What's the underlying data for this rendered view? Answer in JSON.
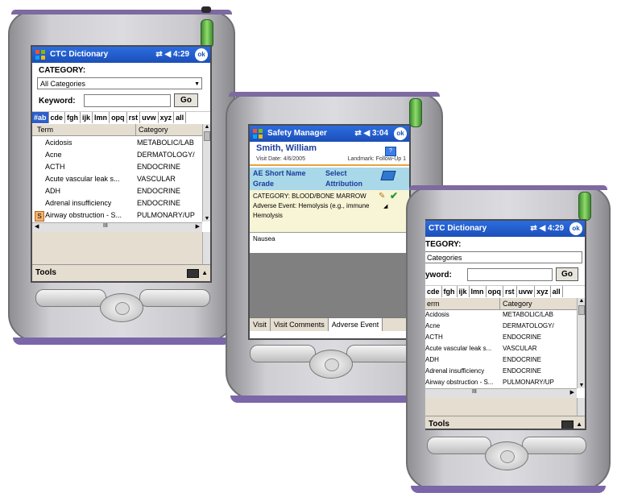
{
  "devices": {
    "left": {
      "titlebar": {
        "app_title": "CTC Dictionary",
        "status": "⇄ ◀ 4:29",
        "ok_label": "ok"
      },
      "category": {
        "label": "CATEGORY:",
        "value": "All Categories"
      },
      "keyword": {
        "label": "Keyword:",
        "value": "",
        "go_label": "Go"
      },
      "alpha_tabs": [
        "#ab",
        "cde",
        "fgh",
        "ijk",
        "lmn",
        "opq",
        "rst",
        "uvw",
        "xyz",
        "all"
      ],
      "alpha_selected": "#ab",
      "columns": [
        "Term",
        "Category"
      ],
      "rows": [
        {
          "term": "Acidosis",
          "category": "METABOLIC/LAB"
        },
        {
          "term": "Acne",
          "category": "DERMATOLOGY/"
        },
        {
          "term": "ACTH",
          "category": "ENDOCRINE"
        },
        {
          "term": "Acute vascular leak s...",
          "category": "VASCULAR"
        },
        {
          "term": "ADH",
          "category": "ENDOCRINE"
        },
        {
          "term": "Adrenal insufficiency",
          "category": "ENDOCRINE"
        },
        {
          "term": "Airway obstruction - S...",
          "category": "PULMONARY/UP"
        }
      ],
      "hscroll_label": "III",
      "toolbar_label": "Tools"
    },
    "middle": {
      "titlebar": {
        "app_title": "Safety Manager",
        "status": "⇄ ◀ 3:04",
        "ok_label": "ok"
      },
      "patient": {
        "name": "Smith, William",
        "visit_date": "Visit Date:  4/6/2005",
        "landmark": "Landmark: Follow-Up 1"
      },
      "grid_header": {
        "col1": "AE Short Name",
        "col2": "Select",
        "col1b": "Grade",
        "col2b": "Attribution"
      },
      "entry": {
        "category": "CATEGORY:  BLOOD/BONE MARROW",
        "adverse_event": "Adverse Event:  Hemolysis (e.g., immune",
        "adverse_event_cont": "Hemolysis"
      },
      "nausea": "Nausea",
      "tabs": [
        "Visit",
        "Visit Comments",
        "Adverse Event"
      ],
      "tab_selected": "Adverse Event"
    },
    "right": {
      "titlebar": {
        "app_title": "CTC Dictionary",
        "status": "⇄ ◀ 4:29",
        "ok_label": "ok"
      },
      "category": {
        "label": "TEGORY:",
        "value": "Categories"
      },
      "keyword": {
        "label": "yword:",
        "value": "",
        "go_label": "Go"
      },
      "alpha_tabs": [
        "cde",
        "fgh",
        "ijk",
        "lmn",
        "opq",
        "rst",
        "uvw",
        "xyz",
        "all"
      ],
      "columns": [
        "erm",
        "Category"
      ],
      "rows": [
        {
          "term": "Acidosis",
          "category": "METABOLIC/LAB"
        },
        {
          "term": "Acne",
          "category": "DERMATOLOGY/"
        },
        {
          "term": "ACTH",
          "category": "ENDOCRINE"
        },
        {
          "term": "Acute vascular leak s...",
          "category": "VASCULAR"
        },
        {
          "term": "ADH",
          "category": "ENDOCRINE"
        },
        {
          "term": "Adrenal insufficiency",
          "category": "ENDOCRINE"
        },
        {
          "term": "Airway obstruction - S...",
          "category": "PULMONARY/UP"
        }
      ],
      "hscroll_label": "III",
      "toolbar_label": "Tools"
    }
  },
  "colors": {
    "titlebar": "#1c4fb8",
    "device_trim": "#7a66a8",
    "stylus": "#5db545",
    "form_band": "#f8f4d6",
    "header_band": "#a9d8e8"
  }
}
